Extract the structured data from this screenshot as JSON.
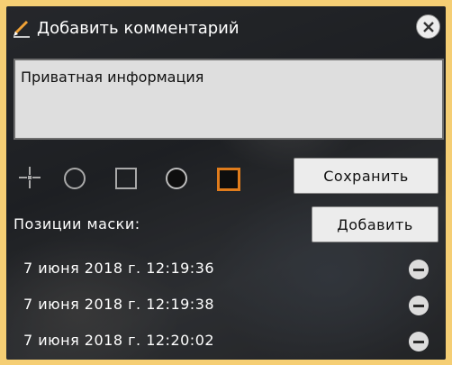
{
  "dialog": {
    "title": "Добавить комментарий",
    "close_icon": "close-icon",
    "comment_text": "Приватная информация"
  },
  "tools": [
    {
      "name": "point-tool",
      "icon": "crosshair-icon"
    },
    {
      "name": "circle-outline-tool",
      "icon": "circle-outline-icon"
    },
    {
      "name": "square-outline-tool",
      "icon": "square-outline-icon"
    },
    {
      "name": "circle-filled-tool",
      "icon": "circle-filled-icon"
    },
    {
      "name": "square-filled-tool",
      "icon": "square-filled-icon",
      "selected": true
    }
  ],
  "buttons": {
    "save": "Сохранить",
    "add": "Добавить"
  },
  "mask": {
    "label": "Позиции маски:",
    "positions": [
      "7 июня 2018 г. 12:19:36",
      "7 июня 2018 г. 12:19:38",
      "7 июня 2018 г. 12:20:02"
    ]
  },
  "colors": {
    "page_background": "#f5ce74",
    "selected_accent": "#e07c1c",
    "pencil_accent": "#f0a236"
  }
}
